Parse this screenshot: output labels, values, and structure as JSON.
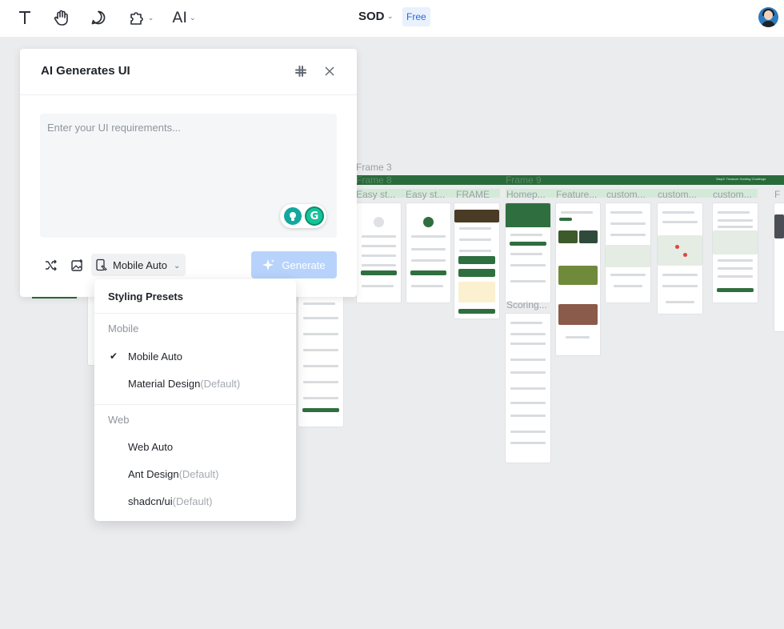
{
  "toolbar": {
    "ai_label": "AI",
    "document_name": "SOD",
    "plan_badge": "Free"
  },
  "canvas": {
    "frame_labels": [
      "Frame 3",
      "Frame 8",
      "Frame 9",
      "Easy st...",
      "Easy st...",
      "FRAME",
      "Homep...",
      "Feature...",
      "custom...",
      "custom...",
      "custom...",
      "F",
      "Scoring..."
    ],
    "banner_text": "Step3: Treasure Hunting Challenge"
  },
  "ai_panel": {
    "title": "AI Generates UI",
    "requirements_value": "",
    "requirements_placeholder": "Enter your UI requirements...",
    "preset_selected": "Mobile Auto",
    "generate_label": "Generate"
  },
  "styling_presets": {
    "title": "Styling Presets",
    "groups": [
      {
        "label": "Mobile",
        "items": [
          {
            "label": "Mobile Auto",
            "suffix": "",
            "selected": true
          },
          {
            "label": "Material Design",
            "suffix": "(Default)",
            "selected": false
          }
        ]
      },
      {
        "label": "Web",
        "items": [
          {
            "label": "Web Auto",
            "suffix": "",
            "selected": false
          },
          {
            "label": "Ant Design",
            "suffix": "(Default)",
            "selected": false
          },
          {
            "label": "shadcn/ui",
            "suffix": "(Default)",
            "selected": false
          }
        ]
      }
    ]
  },
  "colors": {
    "accent_blue": "#2e6ad0",
    "generate_disabled": "#b7d3fb",
    "frame_green": "#2a6b3c"
  }
}
